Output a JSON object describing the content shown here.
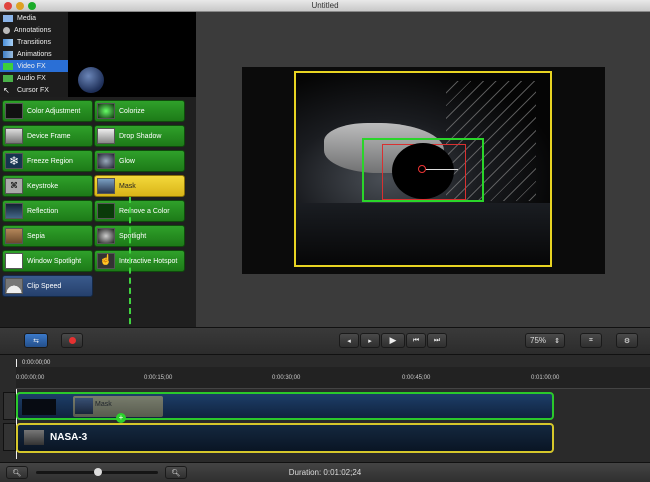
{
  "window": {
    "title": "Untitled"
  },
  "menu": {
    "items": [
      {
        "label": "Media",
        "icon": "media-icon"
      },
      {
        "label": "Annotations",
        "icon": "annotations-icon"
      },
      {
        "label": "Transitions",
        "icon": "transitions-icon"
      },
      {
        "label": "Animations",
        "icon": "animations-icon"
      },
      {
        "label": "Video FX",
        "icon": "video-fx-icon",
        "active": true
      },
      {
        "label": "Audio FX",
        "icon": "audio-fx-icon"
      },
      {
        "label": "Cursor FX",
        "icon": "cursor-fx-icon"
      }
    ]
  },
  "fx": {
    "items": [
      "Color Adjustment",
      "Colorize",
      "Device Frame",
      "Drop Shadow",
      "Freeze Region",
      "Glow",
      "Keystroke",
      "Mask",
      "Reflection",
      "Remove a Color",
      "Sepia",
      "Spotlight",
      "Window Spotlight",
      "Interactive Hotspot",
      "Clip Speed"
    ],
    "selected": "Mask"
  },
  "toolbar": {
    "zoom": "75%"
  },
  "timeline": {
    "playhead": "0:00:00;00",
    "ticks": [
      "0:00:00;00",
      "0:00:15;00",
      "0:00:30;00",
      "0:00:45;00",
      "0:01:00;00"
    ],
    "mask_clip_label": "Mask",
    "nasa_label": "NASA-3"
  },
  "status": {
    "duration": "Duration: 0:01:02;24"
  },
  "colors": {
    "accent_green": "#2bc82b",
    "selection_yellow": "#d6c72b",
    "menu_active": "#2a6fd6"
  }
}
